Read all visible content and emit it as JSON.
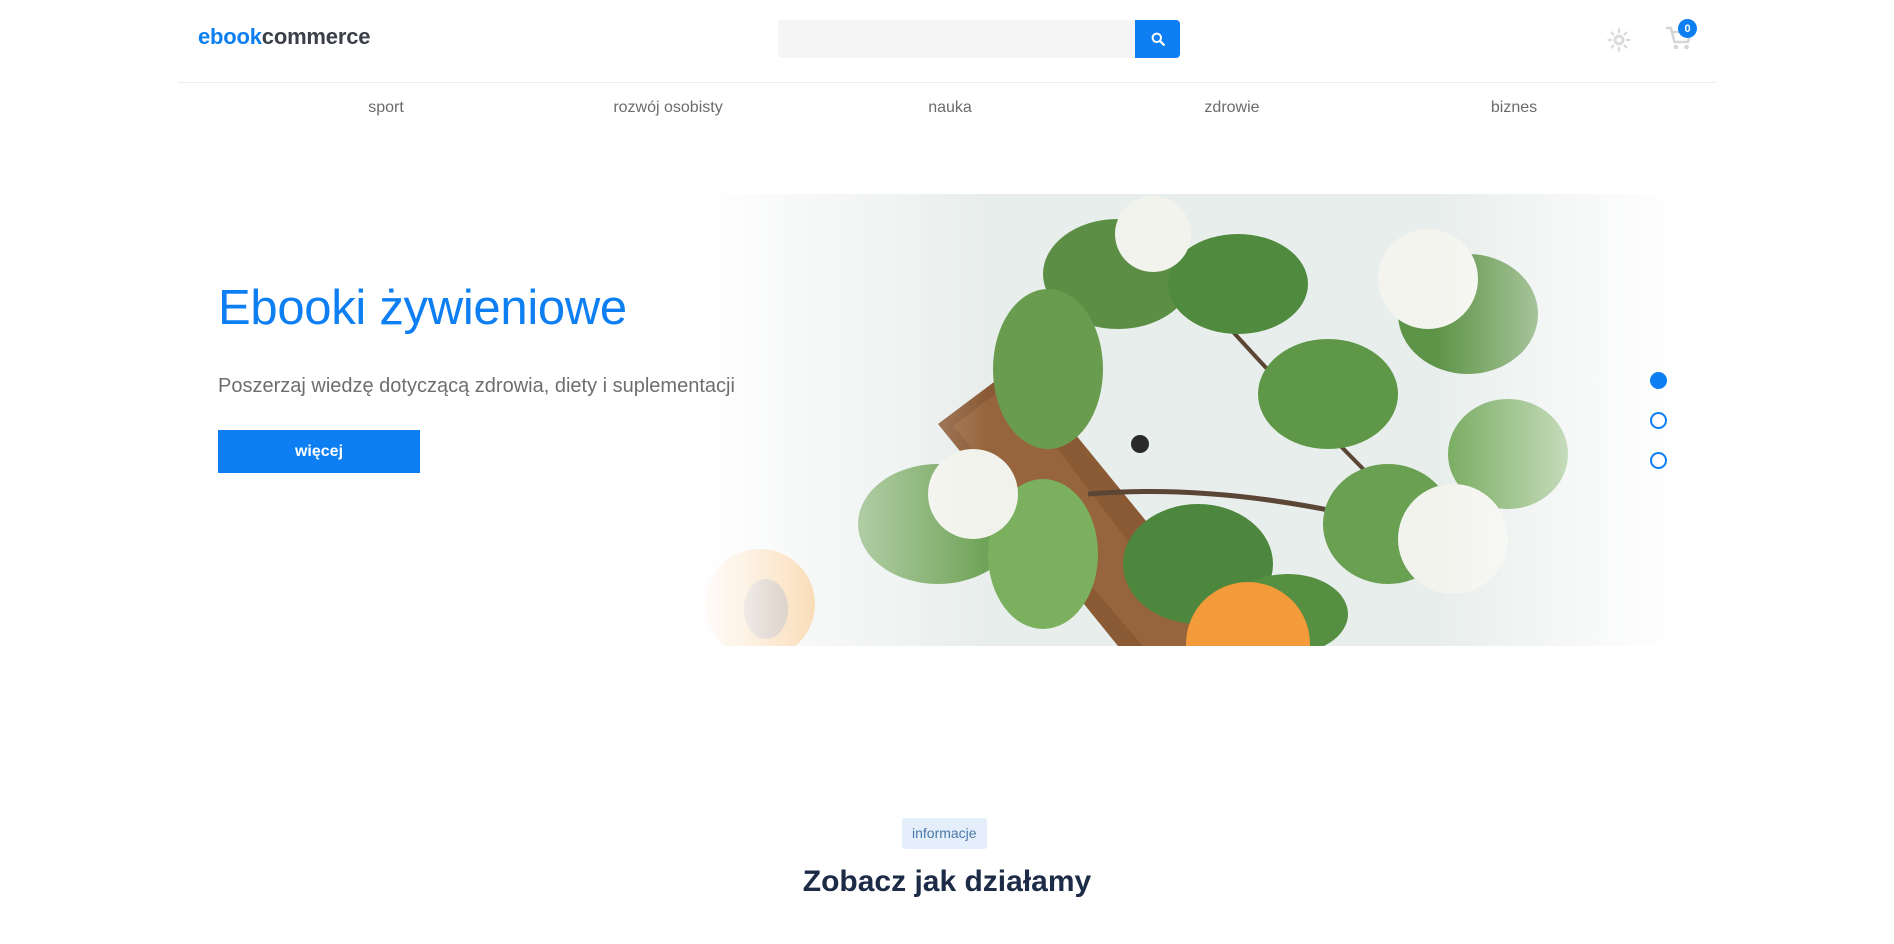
{
  "header": {
    "logo": {
      "accent": "ebook",
      "rest": "commerce"
    },
    "search": {
      "value": "",
      "placeholder": "",
      "button_icon": "search-icon"
    },
    "theme_icon": "sun-icon",
    "cart": {
      "icon": "cart-icon",
      "count": "0"
    }
  },
  "nav": {
    "items": [
      {
        "label": "sport"
      },
      {
        "label": "rozwój osobisty"
      },
      {
        "label": "nauka"
      },
      {
        "label": "zdrowie"
      },
      {
        "label": "biznes"
      }
    ]
  },
  "hero": {
    "title": "Ebooki żywieniowe",
    "subtitle": "Poszerzaj wiedzę dotyczącą zdrowia, diety i suplementacji",
    "button_label": "więcej",
    "slides_total": 3,
    "active_slide": 1
  },
  "info": {
    "badge": "informacje",
    "title": "Zobacz jak działamy"
  },
  "colors": {
    "accent": "#0d7ff2",
    "title_dark": "#1c2b46",
    "badge_bg": "#e4effb"
  }
}
